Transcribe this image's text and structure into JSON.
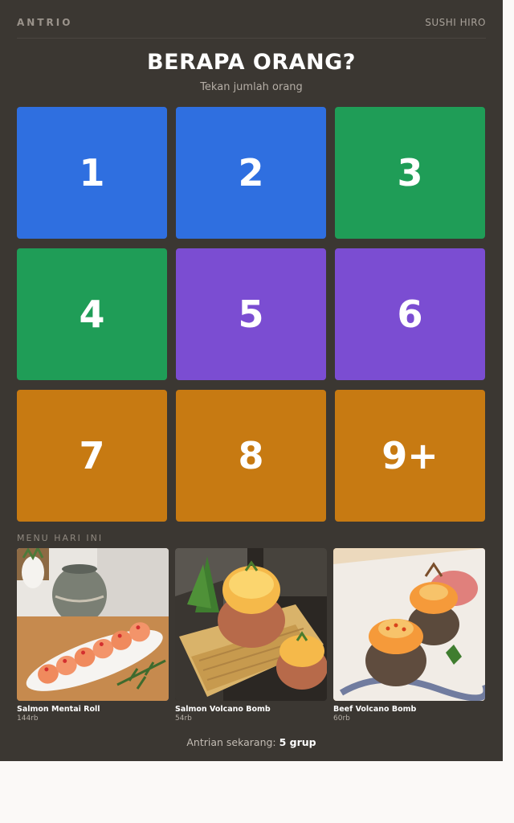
{
  "header": {
    "brand": "ANTRIO",
    "store": "SUSHI HIRO"
  },
  "prompt": {
    "title": "BERAPA ORANG?",
    "subtitle": "Tekan jumlah orang"
  },
  "party_sizes": [
    {
      "label": "1",
      "color": "#2f6fe0"
    },
    {
      "label": "2",
      "color": "#2f6fe0"
    },
    {
      "label": "3",
      "color": "#1f9d57"
    },
    {
      "label": "4",
      "color": "#1f9d57"
    },
    {
      "label": "5",
      "color": "#7b4dd2"
    },
    {
      "label": "6",
      "color": "#7b4dd2"
    },
    {
      "label": "7",
      "color": "#c77a12"
    },
    {
      "label": "8",
      "color": "#c77a12"
    },
    {
      "label": "9+",
      "color": "#c77a12"
    }
  ],
  "menu": {
    "label": "MENU HARI INI",
    "items": [
      {
        "name": "Salmon Mentai Roll",
        "price": "144rb"
      },
      {
        "name": "Salmon Volcano Bomb",
        "price": "54rb"
      },
      {
        "name": "Beef Volcano Bomb",
        "price": "60rb"
      }
    ]
  },
  "queue": {
    "prefix": "Antrian sekarang:",
    "value": "5 grup"
  }
}
